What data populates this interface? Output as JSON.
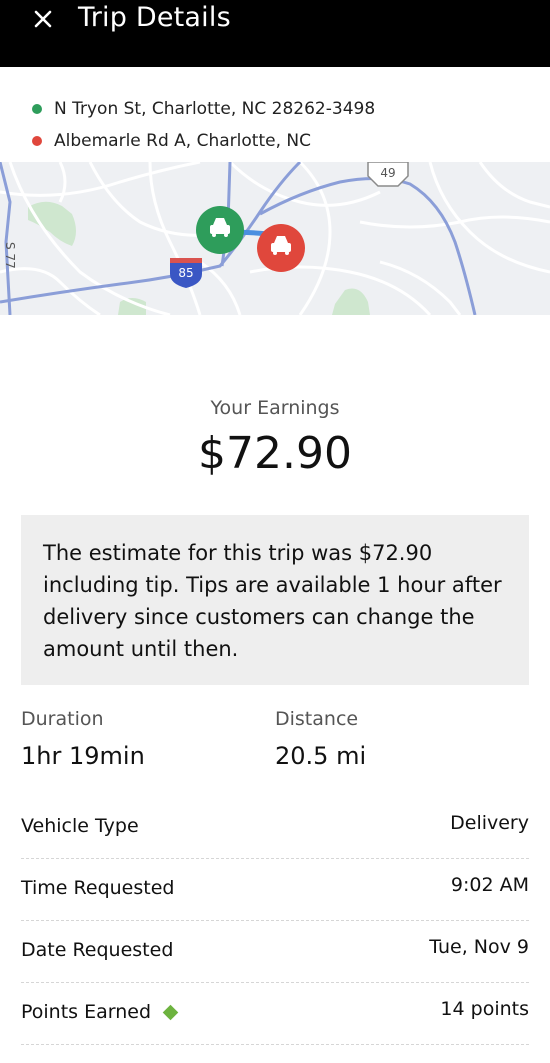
{
  "header": {
    "title": "Trip Details",
    "close_icon": "close-icon"
  },
  "locations": {
    "pickup": {
      "address": "N Tryon St, Charlotte, NC 28262-3498",
      "color": "#2e9d5b"
    },
    "dropoff": {
      "address": "Albemarle Rd A, Charlotte, NC",
      "color": "#e0473c"
    }
  },
  "map": {
    "shield_interstate": "85",
    "shield_highway": "49",
    "edge_label": "S 77",
    "pickup_marker_icon": "car-icon",
    "dropoff_marker_icon": "car-icon"
  },
  "earnings": {
    "label": "Your Earnings",
    "amount": "$72.90"
  },
  "notice": {
    "text": "The estimate for this trip was $72.90 including tip. Tips are available 1 hour after delivery since customers can change the amount until then."
  },
  "stats": {
    "duration": {
      "label": "Duration",
      "value": "1hr 19min"
    },
    "distance": {
      "label": "Distance",
      "value": "20.5 mi"
    }
  },
  "details": [
    {
      "label": "Vehicle Type",
      "value": "Delivery"
    },
    {
      "label": "Time Requested",
      "value": "9:02 AM"
    },
    {
      "label": "Date Requested",
      "value": "Tue, Nov 9"
    },
    {
      "label": "Points Earned",
      "value": "14 points",
      "icon": "diamond-icon"
    }
  ],
  "colors": {
    "header_bg": "#000000",
    "notice_bg": "#eeeeee",
    "points_diamond": "#6db33f"
  }
}
